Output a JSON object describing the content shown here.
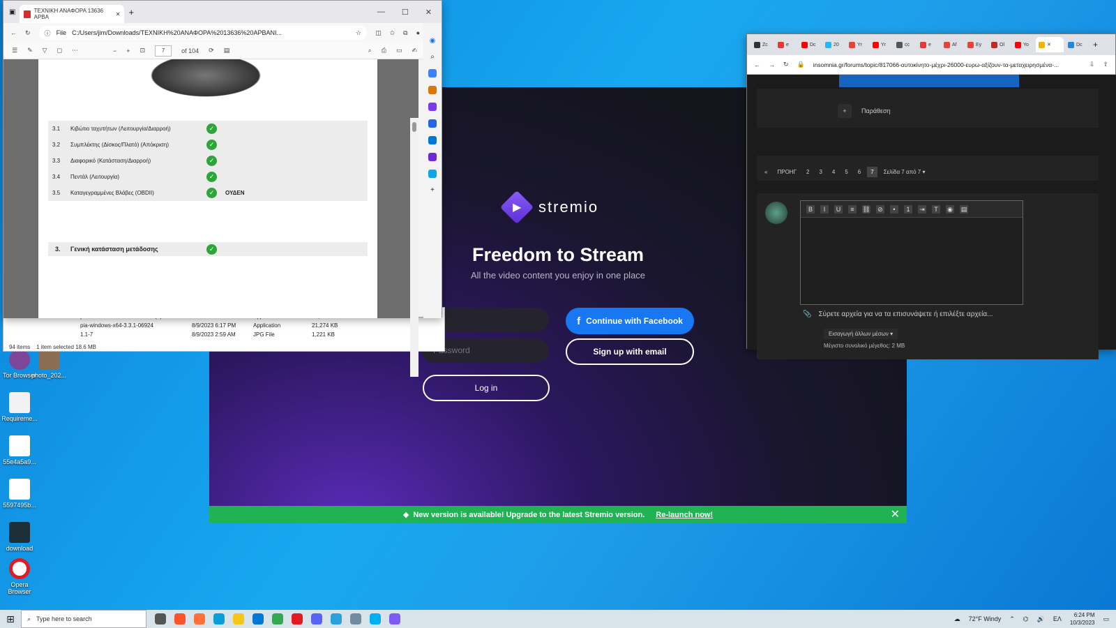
{
  "pdf_window": {
    "tab_title": "ΤΕΧΝΙΚΗ ΑΝΑΦΟΡΑ 13636 ΑΡΒΑ",
    "address_scheme": "File",
    "address": "C:/Users/jim/Downloads/ΤΕΧΝΙΚΗ%20ΑΝΑΦΟΡΑ%2013636%20ΑΡΒΑΝΙ...",
    "page_current": "7",
    "page_total": "of 104",
    "rows": [
      {
        "num": "3.1",
        "label": "Κιβώτιο ταχυτήτων (Λειτουργία/Διαρροή)",
        "extra": ""
      },
      {
        "num": "3.2",
        "label": "Συμπλέκτης (Δίσκος/Πλατό) (Απόκριση)",
        "extra": ""
      },
      {
        "num": "3.3",
        "label": "Διαφορικό (Κατάσταση/Διαρροή)",
        "extra": ""
      },
      {
        "num": "3.4",
        "label": "Πεντάλ (Λειτουργία)",
        "extra": ""
      },
      {
        "num": "3.5",
        "label": "Καταγεγραμμένες Βλάβες  (OBDII)",
        "extra": "ΟΥΔΕΝ"
      }
    ],
    "section": {
      "num": "3.",
      "label": "Γενική κατάσταση μετάδοσης"
    }
  },
  "explorer": {
    "files": [
      {
        "name": "pia-windows-x64-3.3.1-06924 (1)",
        "date": "8/9/2023 6:17 PM",
        "type": "Application",
        "size": "21,274 KB"
      },
      {
        "name": "pia-windows-x64-3.3.1-06924",
        "date": "8/9/2023 6:17 PM",
        "type": "Application",
        "size": "21,274 KB"
      },
      {
        "name": "1.1-7",
        "date": "8/9/2023 2:59 AM",
        "type": "JPG File",
        "size": "1,221 KB"
      }
    ],
    "status_items": "94 items",
    "status_selected": "1 item selected  18.6 MB"
  },
  "stremio": {
    "brand": "stremio",
    "title": "Freedom to Stream",
    "subtitle": "All the video content you enjoy in one place",
    "email_placeholder": "ail",
    "password_placeholder": "Password",
    "facebook_button": "Continue with Facebook",
    "signup_button": "Sign up with email",
    "login_button": "Log in",
    "banner_text": "New version is available! Upgrade to the latest Stremio version.",
    "banner_link": "Re-launch now!"
  },
  "chrome_window": {
    "tabs": [
      "Zc",
      "e",
      "Dc",
      "20",
      "Yr",
      "Yr",
      "cc",
      "e",
      "Af",
      "Ey",
      "Ol",
      "Yo",
      "",
      "Dc"
    ],
    "url": "insomnia.gr/forums/topic/817066-αυτοκίνητο-μέχρι-26000-ευρω-αξίζουν-τα-μεταχειρησμένα-...",
    "quote_label": "Παράθεση",
    "pager_prev": "«",
    "pager_prev_label": "ΠΡΟΗΓ",
    "pages": [
      "2",
      "3",
      "4",
      "5",
      "6",
      "7"
    ],
    "page_indicator": "Σελίδα 7 από 7 ▾",
    "attach_text": "Σύρετε αρχεία για να τα επισυνάψετε ή επιλέξτε αρχεία...",
    "media_button": "Εισαγωγή άλλων μέσων ▾",
    "max_size": "Μέγιστο συνολικό μέγεθος: 2 MB"
  },
  "desktop_icons": [
    "Tor Browser",
    "photo_202...",
    "Requireme...",
    "55e4a5a9...",
    "5597495b...",
    "download",
    "Opera Browser"
  ],
  "taskbar": {
    "search_placeholder": "Type here to search",
    "weather": "72°F  Windy",
    "lang": "ΕΛ",
    "time": "6:24 PM",
    "date": "10/3/2023"
  }
}
